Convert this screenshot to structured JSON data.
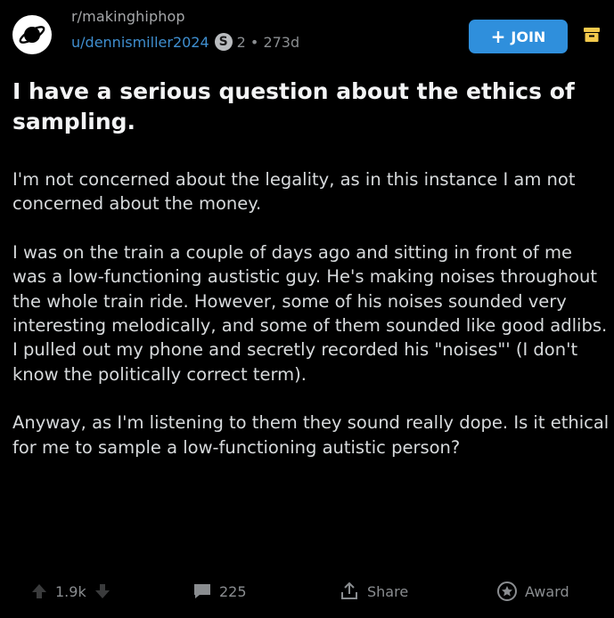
{
  "post": {
    "subreddit": "r/makinghiphop",
    "author": "u/dennismiller2024",
    "status_icon_glyph": "S",
    "meta_suffix": "2 • 273d",
    "join_label": "JOIN",
    "title": "I have a serious question about the ethics of sampling.",
    "paragraphs": [
      "I'm not concerned about the legality, as in this instance I am not concerned about the money.",
      "I was on the train a couple of days ago and sitting in front of me was a low-functioning austistic guy. He's making noises throughout the whole train ride. However, some of his noises sounded very interesting melodically, and some of them sounded like good adlibs. I pulled out my phone and secretly recorded his \"noises\"' (I don't know the politically correct term).",
      "Anyway, as I'm listening to them they sound really dope. Is it ethical for me to sample a low-functioning autistic person?"
    ]
  },
  "actions": {
    "votes": "1.9k",
    "comments": "225",
    "share": "Share",
    "award": "Award"
  },
  "icons": {
    "avatar": "planet-avatar-icon",
    "archive": "archive-box-icon",
    "upvote": "upvote-arrow-icon",
    "downvote": "downvote-arrow-icon",
    "comment": "comment-bubble-icon",
    "share": "share-icon",
    "award": "award-icon"
  },
  "colors": {
    "background": "#000000",
    "text": "#d7dadc",
    "muted": "#8a8d90",
    "link": "#3f8fd0",
    "join": "#2f8fdc",
    "archive": "#f2c94c"
  }
}
